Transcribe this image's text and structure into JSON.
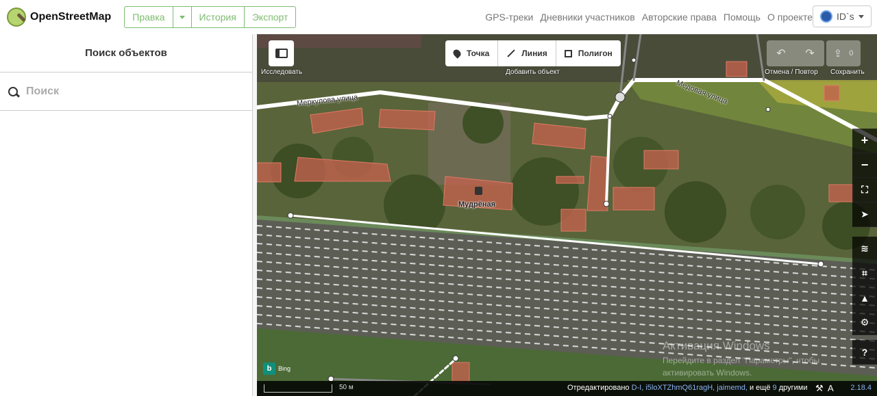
{
  "header": {
    "logo_text": "OpenStreetMap",
    "edit_label": "Правка",
    "history_label": "История",
    "export_label": "Экспорт",
    "links": [
      "GPS-треки",
      "Дневники участников",
      "Авторские права",
      "Помощь",
      "О проекте"
    ],
    "user_label": "ID`s"
  },
  "sidebar": {
    "title": "Поиск объектов",
    "search_placeholder": "Поиск"
  },
  "map": {
    "explore_label": "Исследовать",
    "add_feature_label": "Добавить объект",
    "point_label": "Точка",
    "line_label": "Линия",
    "area_label": "Полигон",
    "undo_redo_label": "Отмена / Повтор",
    "save_label": "Сохранить",
    "save_count": "0",
    "road_merkulova": "Меркулова улица",
    "road_medovaya": "Медовая улица",
    "place_label": "Мудрёная",
    "imagery_label": "Bing",
    "scale_label": "50 м",
    "footer_edited": "Отредактировано",
    "footer_users": "D-I, i5loXTZhmQ61ragH, jaimemd,",
    "footer_and": "и ещё",
    "footer_count": "9",
    "footer_others": "другими",
    "version": "2.18.4",
    "watermark_title": "Активация Windows",
    "watermark_text": "Перейдите в раздел \"Параметры\", чтобы активировать Windows."
  },
  "colors": {
    "accent": "#7ebc6f",
    "link": "#8bb3f5"
  }
}
